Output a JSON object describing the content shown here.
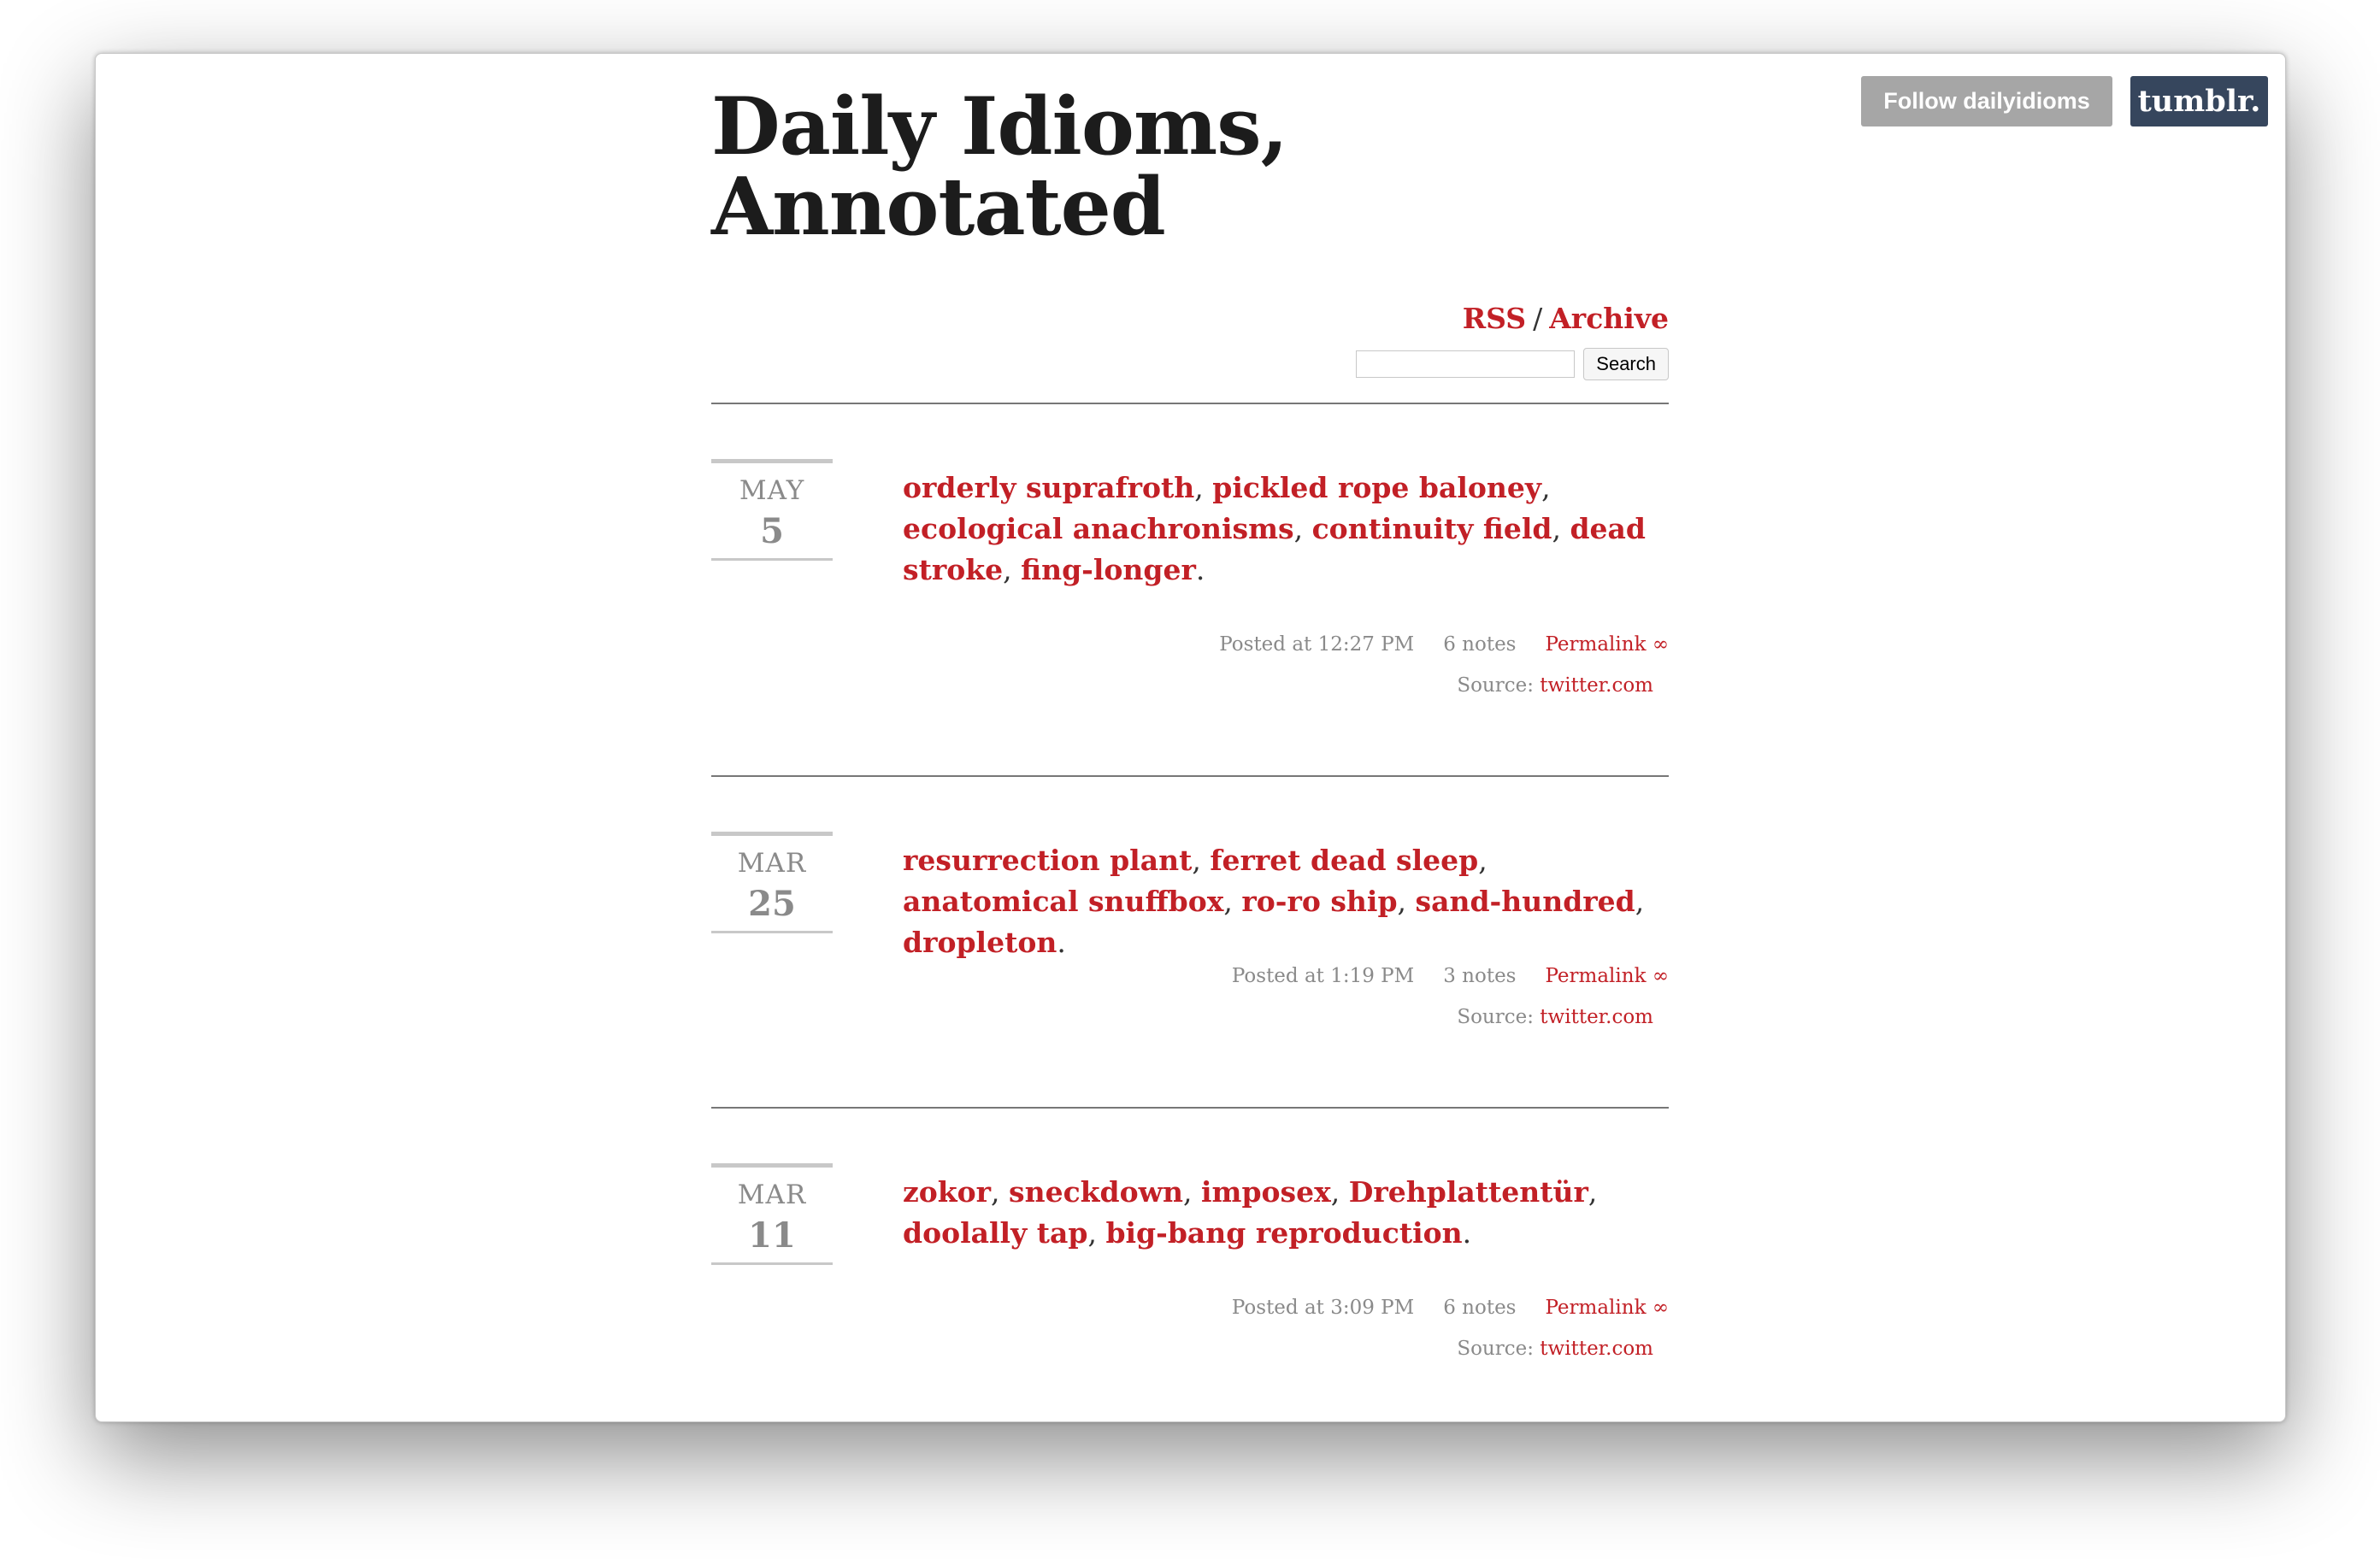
{
  "tumblr": {
    "follow_label": "Follow dailyidioms",
    "logo_text": "tumblr."
  },
  "blog": {
    "title_line1": "Daily Idioms,",
    "title_line2": "Annotated",
    "rss_label": "RSS",
    "separator": "/",
    "archive_label": "Archive"
  },
  "search": {
    "value": "",
    "button_label": "Search"
  },
  "posts": [
    {
      "month": "MAY",
      "day": "5",
      "idioms": [
        "orderly suprafroth",
        "pickled rope baloney",
        "ecological anachronisms",
        "continuity field",
        "dead stroke",
        "fing-longer"
      ],
      "posted": "Posted at 12:27 PM",
      "notes": "6 notes",
      "permalink": "Permalink ∞",
      "source_label": "Source:",
      "source_link": "twitter.com"
    },
    {
      "month": "MAR",
      "day": "25",
      "idioms": [
        "resurrection plant",
        "ferret dead sleep",
        "anatomical snuffbox",
        "ro-ro ship",
        "sand-hundred",
        "dropleton"
      ],
      "posted": "Posted at 1:19 PM",
      "notes": "3 notes",
      "permalink": "Permalink ∞",
      "source_label": "Source:",
      "source_link": "twitter.com"
    },
    {
      "month": "MAR",
      "day": "11",
      "idioms": [
        "zokor",
        "sneckdown",
        "imposex",
        "Drehplattentür",
        "doolally tap",
        "big-bang reproduction"
      ],
      "posted": "Posted at 3:09 PM",
      "notes": "6 notes",
      "permalink": "Permalink ∞",
      "source_label": "Source:",
      "source_link": "twitter.com"
    }
  ],
  "colors": {
    "accent": "#c22026",
    "text": "#1c1c1c",
    "muted": "#8a8a8a",
    "tumblr_blue": "#36465d",
    "follow_gray": "#a6a6a6"
  }
}
